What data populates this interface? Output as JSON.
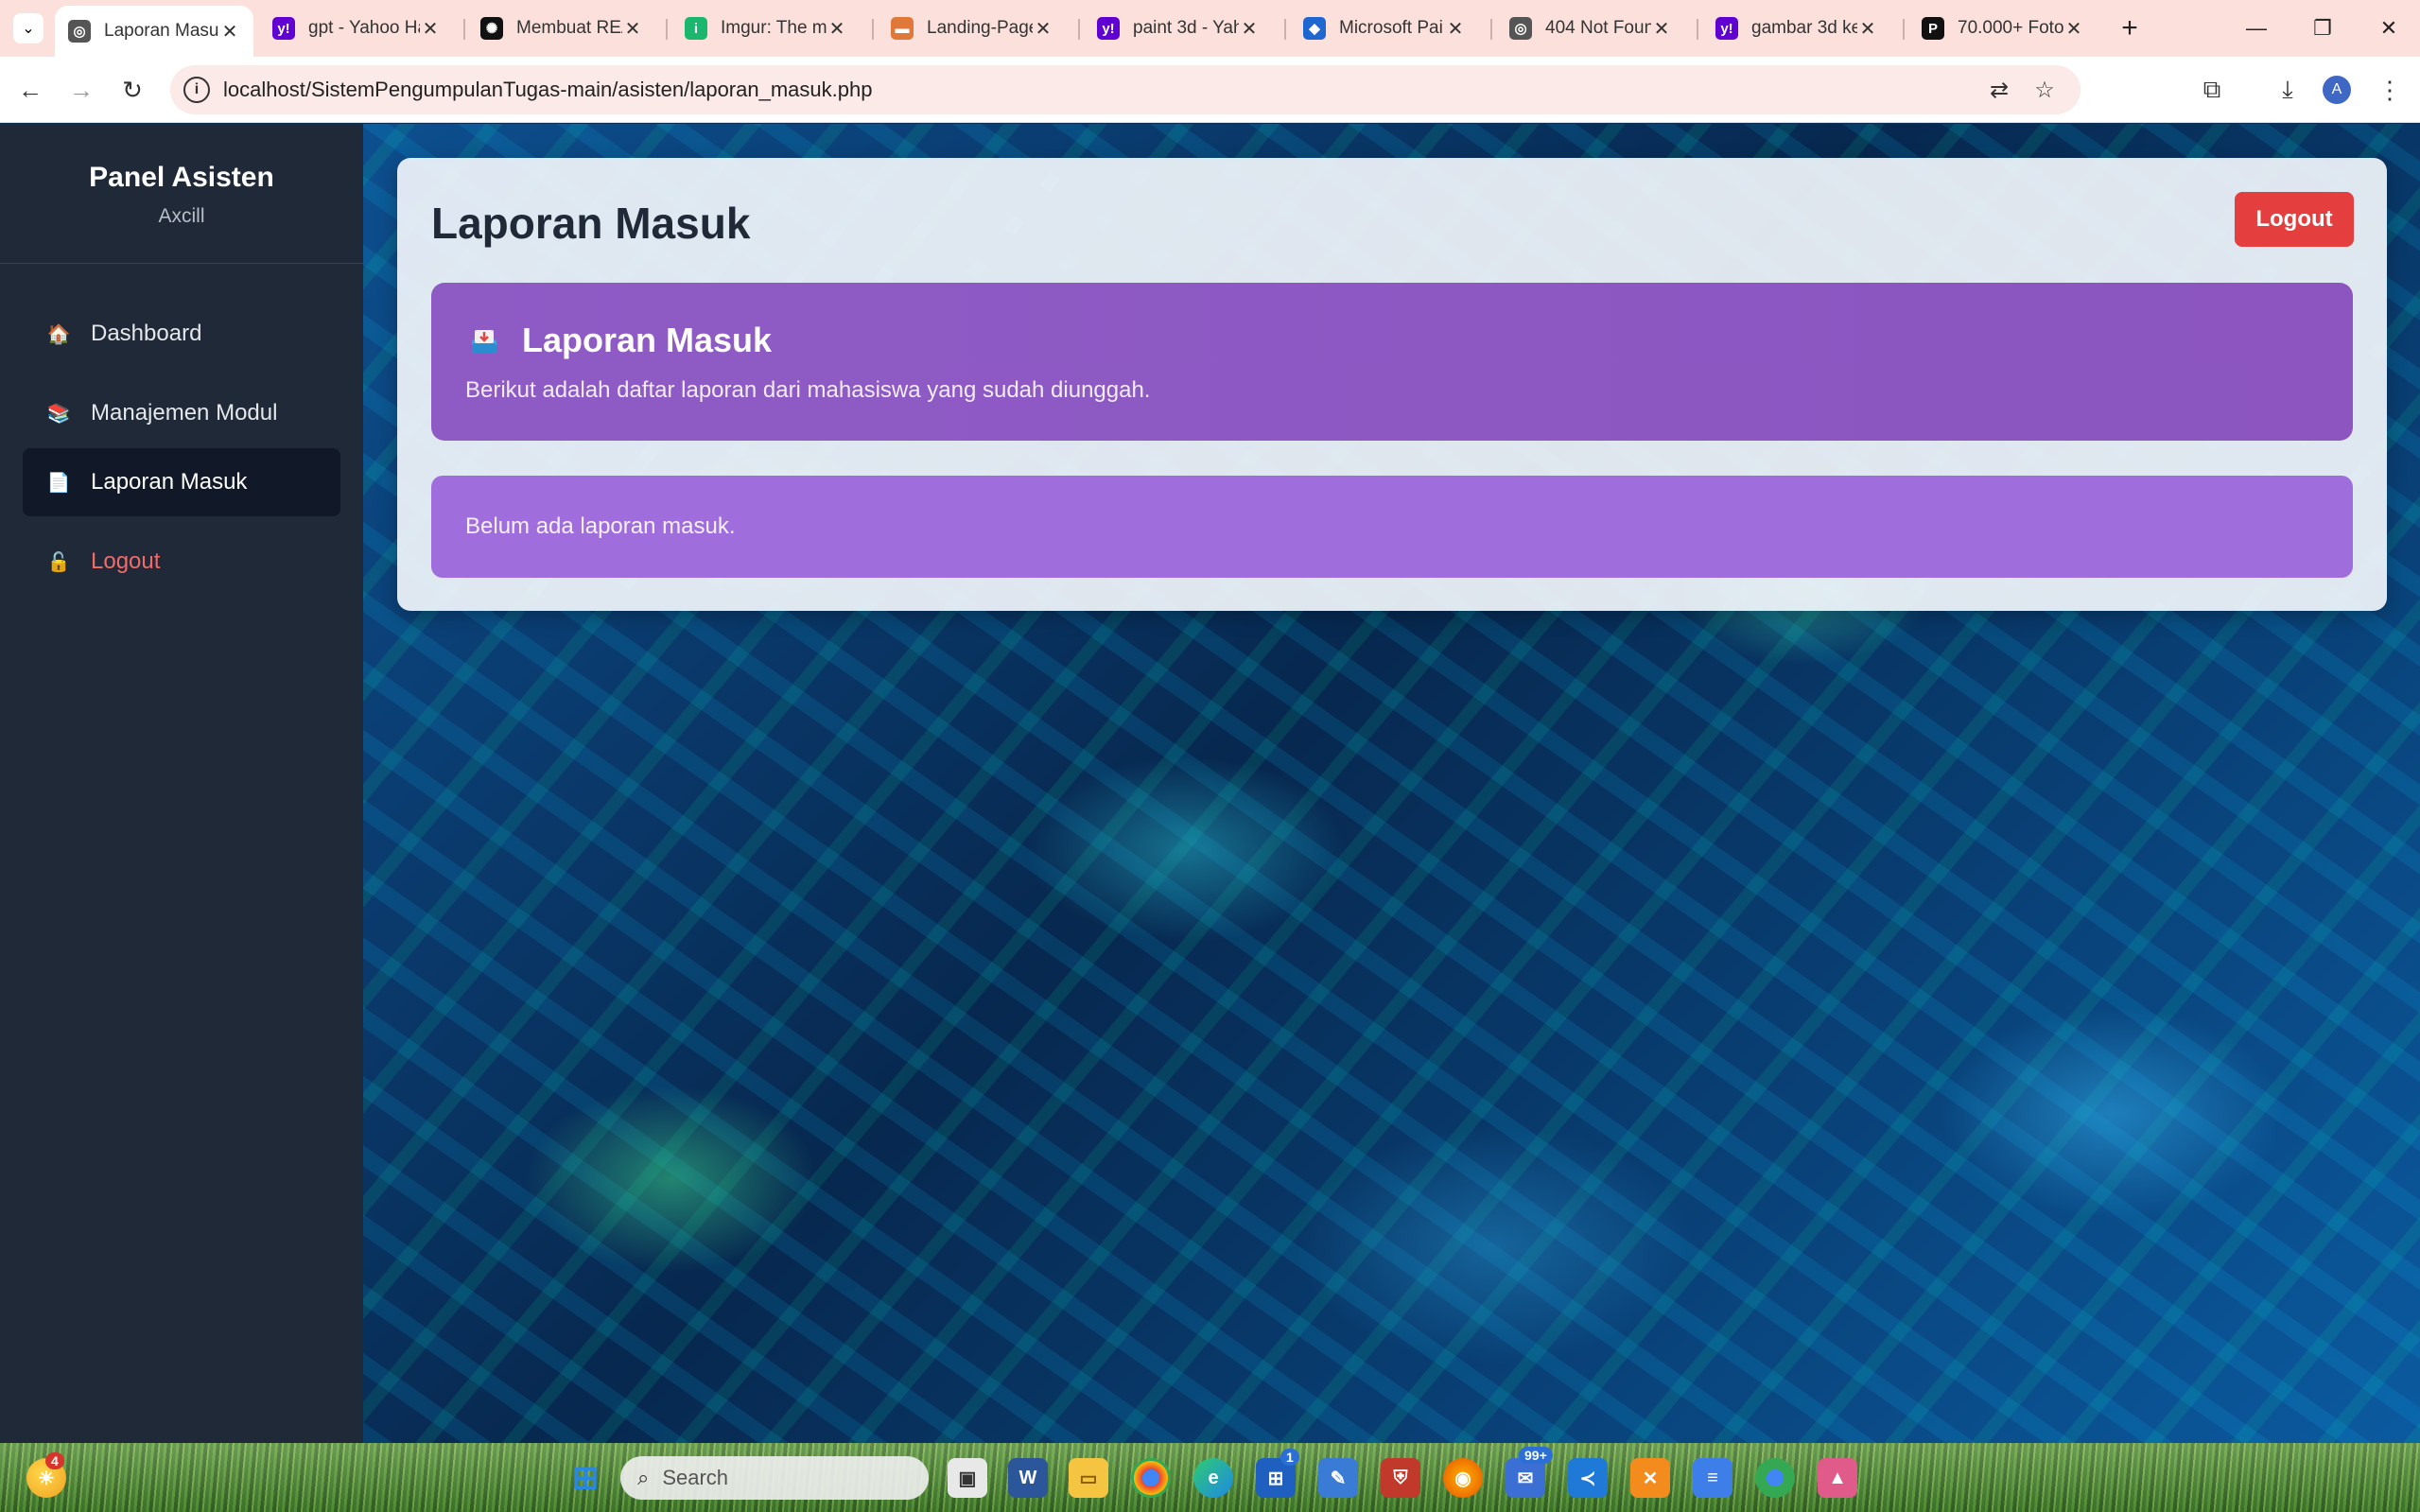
{
  "browser": {
    "tabs": [
      {
        "title": "Laporan Masuk",
        "fav_color": "#555555",
        "fav_glyph": "◎",
        "active": true
      },
      {
        "title": "gpt - Yahoo Hasil",
        "fav_color": "#6001d2",
        "fav_glyph": "y!"
      },
      {
        "title": "Membuat REA",
        "fav_color": "#111111",
        "fav_glyph": "✺"
      },
      {
        "title": "Imgur: The m",
        "fav_color": "#1bb76e",
        "fav_glyph": "i"
      },
      {
        "title": "Landing-Page",
        "fav_color": "#e0783a",
        "fav_glyph": "▬"
      },
      {
        "title": "paint 3d - Yah",
        "fav_color": "#6001d2",
        "fav_glyph": "y!"
      },
      {
        "title": "Microsoft Pai",
        "fav_color": "#1e66d0",
        "fav_glyph": "◆"
      },
      {
        "title": "404 Not Foun",
        "fav_color": "#555555",
        "fav_glyph": "◎"
      },
      {
        "title": "gambar 3d ke",
        "fav_color": "#6001d2",
        "fav_glyph": "y!"
      },
      {
        "title": "70.000+ Foto",
        "fav_color": "#111111",
        "fav_glyph": "P"
      }
    ],
    "url": "localhost/SistemPengumpulanTugas-main/asisten/laporan_masuk.php",
    "profile_initial": "A"
  },
  "sidebar": {
    "title": "Panel Asisten",
    "user": "Axcill",
    "items": [
      {
        "label": "Dashboard",
        "icon": "🏠"
      },
      {
        "label": "Manajemen Modul",
        "icon": "📚"
      },
      {
        "label": "Laporan Masuk",
        "icon": "📄"
      },
      {
        "label": "Logout",
        "icon": "🔓"
      }
    ]
  },
  "main": {
    "page_title": "Laporan Masuk",
    "logout_label": "Logout",
    "banner": {
      "title": "Laporan Masuk",
      "description": "Berikut adalah daftar laporan dari mahasiswa yang sudah diunggah."
    },
    "empty_message": "Belum ada laporan masuk."
  },
  "taskbar": {
    "search_placeholder": "Search",
    "weather_badge": "4",
    "store_badge": "1",
    "notif_badge": "99+"
  },
  "colors": {
    "sidebar_bg": "#1f2937",
    "banner": "#8e5bc5",
    "empty_box": "#a06ddc",
    "logout_button": "#e53e3e",
    "sidebar_logout_text": "#f26b6b"
  }
}
